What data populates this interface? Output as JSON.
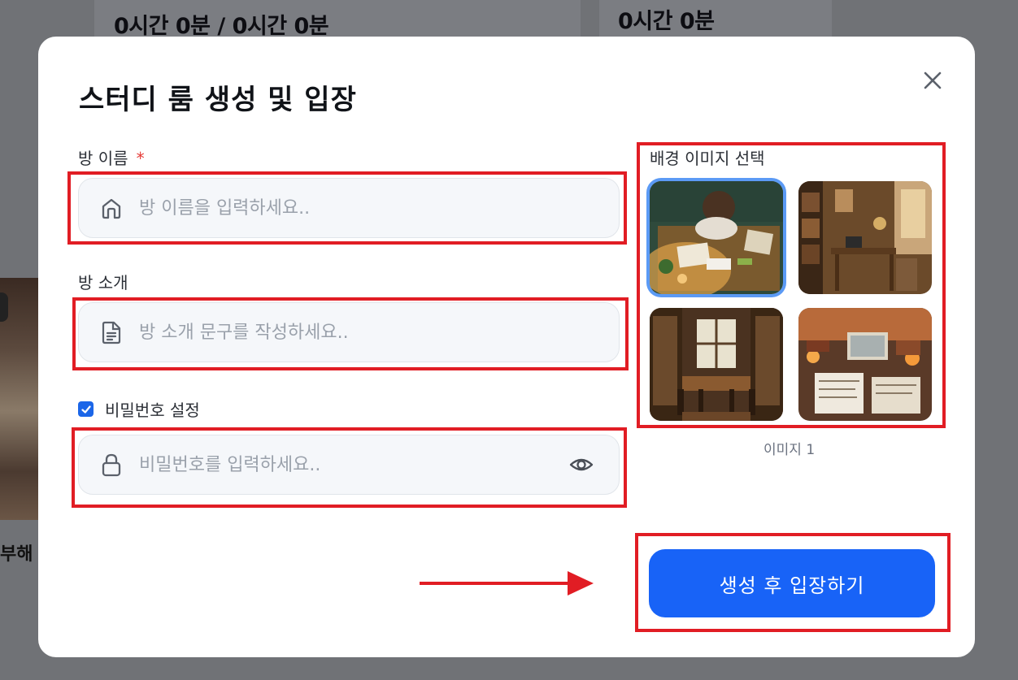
{
  "background": {
    "stat_left": "0시간 0분 / 0시간 0분",
    "stat_right": "0시간 0분",
    "partial_text": "부해"
  },
  "modal": {
    "title": "스터디 룸 생성 및 입장",
    "room_name": {
      "label": "방 이름",
      "required_mark": "*",
      "placeholder": "방 이름을 입력하세요..",
      "icon": "home-icon"
    },
    "room_intro": {
      "label": "방 소개",
      "placeholder": "방 소개 문구를 작성하세요..",
      "icon": "document-icon"
    },
    "password": {
      "checkbox_label": "비밀번호 설정",
      "checked": true,
      "placeholder": "비밀번호를 입력하세요..",
      "icon": "lock-icon",
      "toggle_icon": "eye-icon"
    },
    "background_images": {
      "label": "배경 이미지 선택",
      "options": [
        {
          "name": "desk-overhead",
          "selected": true
        },
        {
          "name": "desk-window",
          "selected": false
        },
        {
          "name": "library-table",
          "selected": false
        },
        {
          "name": "cluttered-desk",
          "selected": false
        }
      ],
      "caption": "이미지 1"
    },
    "submit_label": "생성 후 입장하기"
  },
  "colors": {
    "accent": "#1863f7",
    "annotation": "#e11d24",
    "checkbox": "#1b66e8"
  }
}
